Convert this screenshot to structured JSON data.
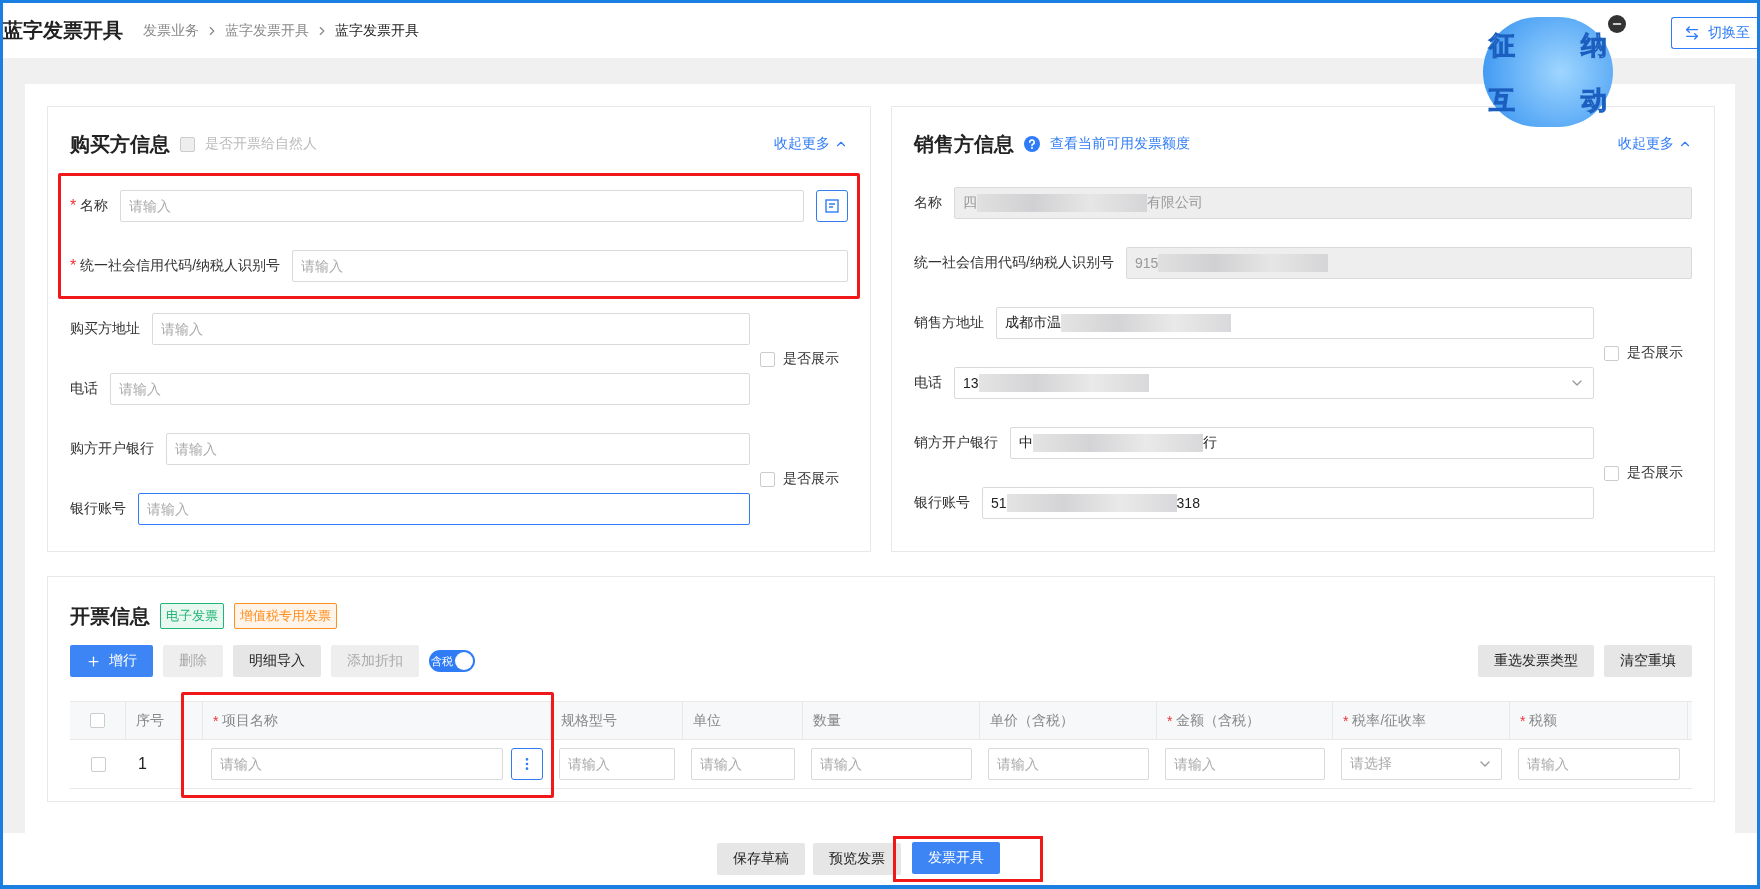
{
  "header": {
    "title": "蓝字发票开具",
    "breadcrumb": [
      "发票业务",
      "蓝字发票开具",
      "蓝字发票开具"
    ],
    "mascot": {
      "chars": [
        "征",
        "纳",
        "互",
        "动"
      ]
    },
    "switch_button": "切换至"
  },
  "buyer": {
    "title": "购买方信息",
    "natural_person": {
      "label": "是否开票给自然人",
      "checked": false,
      "disabled": true
    },
    "collapse": "收起更多",
    "required_group": {
      "highlighted": true,
      "fields": [
        {
          "label": "名称",
          "required_mark": "*",
          "placeholder": "请输入",
          "kind": "lookup"
        },
        {
          "label": "统一社会信用代码/纳税人识别号",
          "required_mark": "*",
          "placeholder": "请输入",
          "kind": "text"
        }
      ]
    },
    "groups": [
      {
        "fields": [
          {
            "label": "购买方地址",
            "placeholder": "请输入",
            "focused": false
          },
          {
            "label": "电话",
            "placeholder": "请输入",
            "focused": false
          }
        ],
        "show": {
          "label": "是否展示",
          "checked": false
        }
      },
      {
        "fields": [
          {
            "label": "购方开户银行",
            "placeholder": "请输入",
            "focused": false
          },
          {
            "label": "银行账号",
            "placeholder": "请输入",
            "focused": true
          }
        ],
        "show": {
          "label": "是否展示",
          "checked": false
        }
      }
    ]
  },
  "seller": {
    "title": "销售方信息",
    "quota_link": "查看当前可用发票额度",
    "collapse": "收起更多",
    "top_fields": [
      {
        "label": "名称",
        "value_start": "四",
        "value_end": "有限公司",
        "disabled": true
      },
      {
        "label": "统一社会信用代码/纳税人识别号",
        "value_start": "915",
        "disabled": true
      }
    ],
    "groups": [
      {
        "fields": [
          {
            "label": "销售方地址",
            "value_start": "成都市温",
            "kind": "text"
          },
          {
            "label": "电话",
            "value_start": "13",
            "kind": "select"
          }
        ],
        "show": {
          "label": "是否展示",
          "checked": false
        }
      },
      {
        "fields": [
          {
            "label": "销方开户银行",
            "value_start": "中",
            "value_end": "行",
            "kind": "text"
          },
          {
            "label": "银行账号",
            "value_start": "51",
            "value_end": "318",
            "kind": "text"
          }
        ],
        "show": {
          "label": "是否展示",
          "checked": false
        }
      }
    ]
  },
  "invoice": {
    "title": "开票信息",
    "tags": [
      {
        "label": "电子发票",
        "color": "#1fb574"
      },
      {
        "label": "增值税专用发票",
        "color": "#ff8f1f"
      }
    ],
    "toolbar": [
      {
        "label": "增行",
        "kind": "primary"
      },
      {
        "label": "删除",
        "kind": "disabled"
      },
      {
        "label": "明细导入",
        "kind": "default"
      },
      {
        "label": "添加折扣",
        "kind": "disabled"
      }
    ],
    "tax_toggle": {
      "label": "含税",
      "on": true
    },
    "right_buttons": [
      "重选发票类型",
      "清空重填"
    ],
    "columns": [
      {
        "kind": "check",
        "checked": false
      },
      {
        "label": "序号",
        "kind": "text"
      },
      {
        "label": "项目名称",
        "required_mark": "*",
        "kind": "text",
        "highlighted": true
      },
      {
        "label": "规格型号",
        "kind": "text"
      },
      {
        "label": "单位",
        "kind": "text"
      },
      {
        "label": "数量",
        "kind": "text"
      },
      {
        "label": "单价（含税）",
        "kind": "text"
      },
      {
        "label": "金额（含税）",
        "required_mark": "*",
        "kind": "text"
      },
      {
        "label": "税率/征收率",
        "required_mark": "*",
        "kind": "text"
      },
      {
        "label": "税额",
        "required_mark": "*",
        "kind": "text"
      }
    ],
    "rows": [
      {
        "checked": false,
        "cells": [
          {
            "kind": "check"
          },
          {
            "kind": "index",
            "text": "1"
          },
          {
            "kind": "lookup",
            "placeholder": "请输入"
          },
          {
            "kind": "input",
            "placeholder": "请输入"
          },
          {
            "kind": "input",
            "placeholder": "请输入"
          },
          {
            "kind": "input",
            "placeholder": "请输入"
          },
          {
            "kind": "input",
            "placeholder": "请输入"
          },
          {
            "kind": "input",
            "placeholder": "请输入"
          },
          {
            "kind": "select",
            "placeholder": "请选择"
          },
          {
            "kind": "input",
            "placeholder": "请输入"
          }
        ]
      }
    ]
  },
  "footer": {
    "buttons": [
      {
        "label": "保存草稿",
        "kind": "default",
        "highlighted": false
      },
      {
        "label": "预览发票",
        "kind": "default",
        "highlighted": false
      },
      {
        "label": "发票开具",
        "kind": "primary",
        "highlighted": true
      }
    ]
  }
}
